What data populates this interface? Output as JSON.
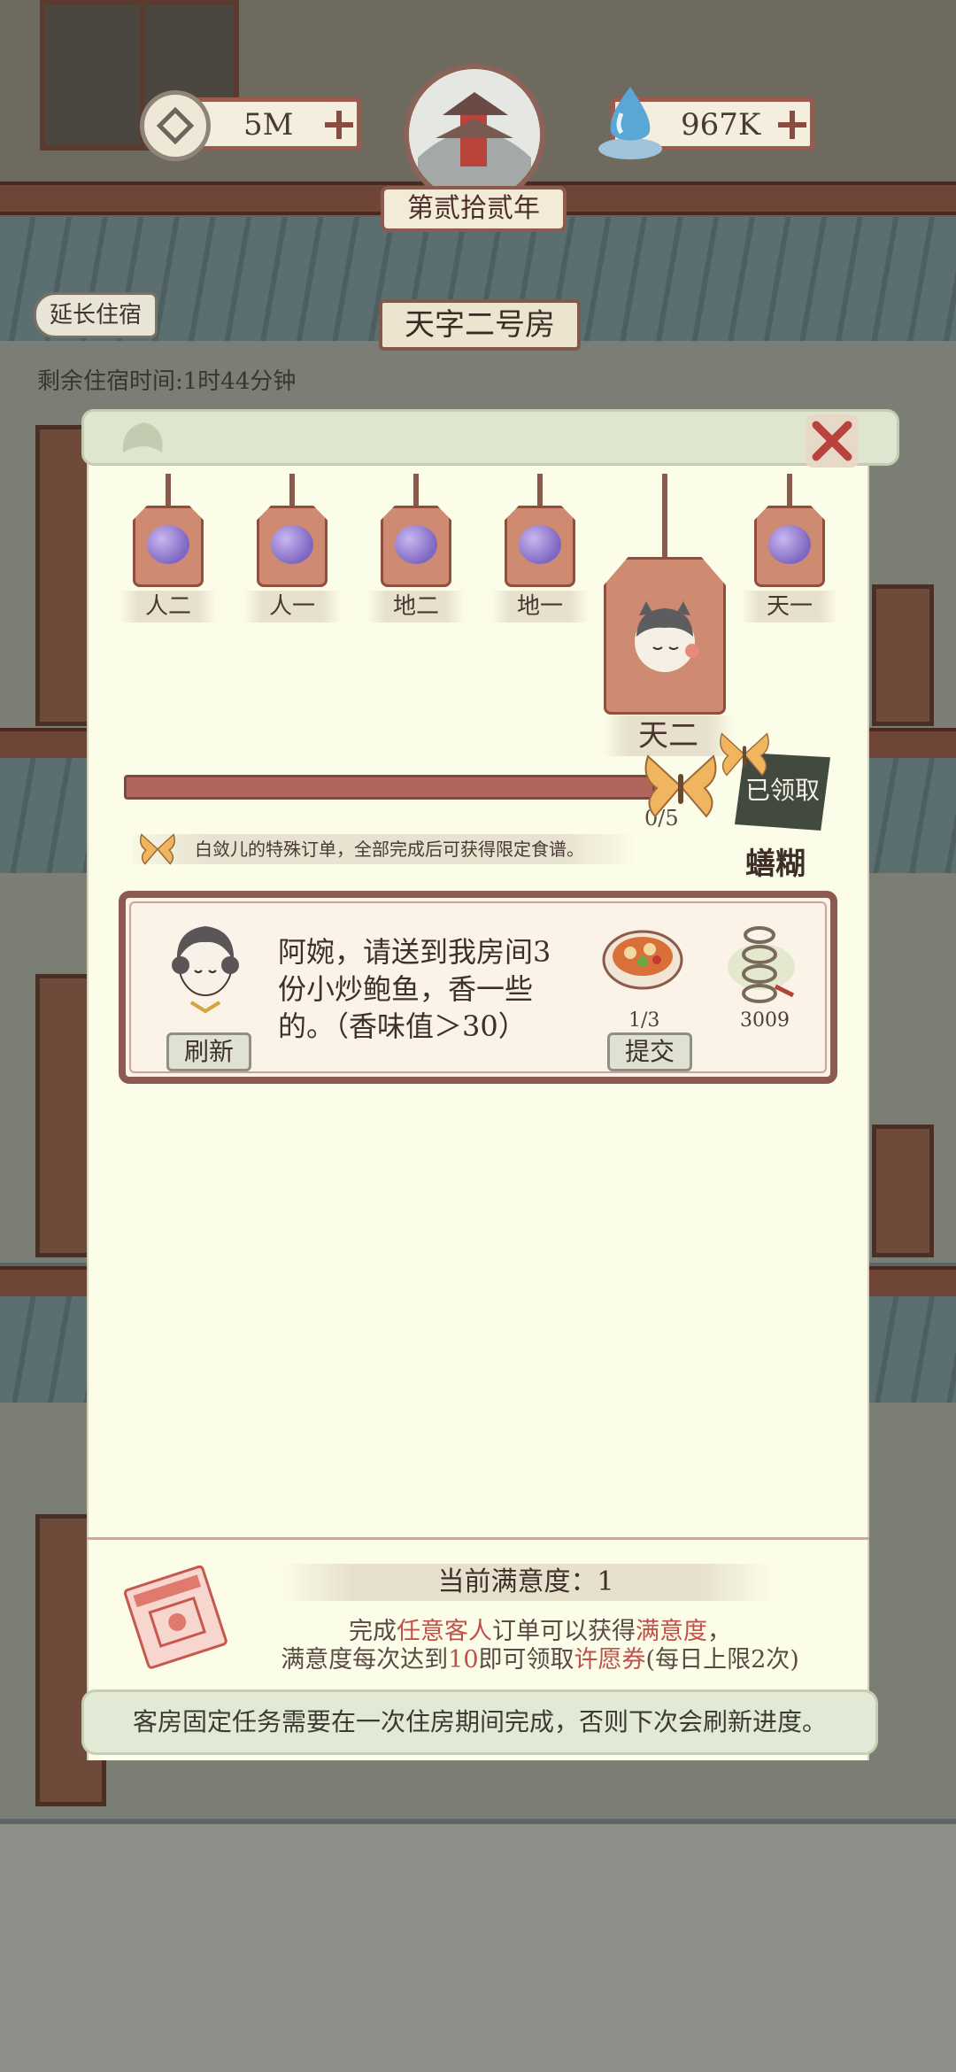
{
  "hud": {
    "coins_value": "5M",
    "wishes_value": "967K",
    "year_label": "第贰拾贰年"
  },
  "room": {
    "extend_label": "延长住宿",
    "title": "天字二号房",
    "remaining_time": "剩余住宿时间:1时44分钟"
  },
  "tags": [
    {
      "label": "人二"
    },
    {
      "label": "人一"
    },
    {
      "label": "地二"
    },
    {
      "label": "地一"
    },
    {
      "label": "天二"
    },
    {
      "label": "天一"
    }
  ],
  "progress": {
    "text": "0/5",
    "fraction": 0,
    "claimed_label": "已领取",
    "reward_name": "蟮糊"
  },
  "notice": "白敛儿的特殊订单，全部完成后可获得限定食谱。",
  "order": {
    "request_text": "阿婉，请送到我房间3份小炒鲍鱼，香一些的。（香味值＞30）",
    "refresh_label": "刷新",
    "submit_label": "提交",
    "dish_count": "1/3",
    "reward_coins": "3009"
  },
  "satisfaction": {
    "title": "当前满意度：1",
    "line1": {
      "a": "完成",
      "b": "任意客人",
      "c": "订单可以获得",
      "d": "满意度",
      "e": "，"
    },
    "line2": {
      "a": "满意度每次达到",
      "b": "10",
      "c": "即可领取",
      "d": "许愿券",
      "e": "(每日上限2次)"
    }
  },
  "footer_note": "客房固定任务需要在一次住房期间完成，否则下次会刷新进度。",
  "colors": {
    "panel": "#fcfde8",
    "accent_red": "#c0504a",
    "tag_body": "#cf8a72",
    "progress_bar": "#b2655d"
  }
}
